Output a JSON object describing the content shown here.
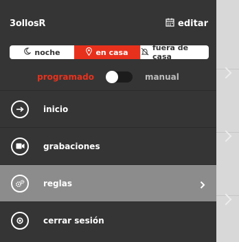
{
  "header": {
    "app_title": "3ollosR",
    "edit_label": "editar"
  },
  "modes": {
    "night": "noche",
    "home": "en casa",
    "away": "fuera de casa",
    "selected": "en casa"
  },
  "schedule": {
    "programmed_label": "programado",
    "manual_label": "manual",
    "toggle_state": "programado"
  },
  "menu": {
    "items": [
      {
        "label": "inicio",
        "icon": "arrow-right-icon"
      },
      {
        "label": "grabaciones",
        "icon": "video-camera-icon"
      },
      {
        "label": "reglas",
        "icon": "gears-icon"
      },
      {
        "label": "cerrar sesión",
        "icon": "power-icon"
      }
    ],
    "active_index": 2
  },
  "colors": {
    "accent": "#e8311d",
    "drawer_bg": "#353535",
    "active_row_bg": "#8c8c8c"
  }
}
